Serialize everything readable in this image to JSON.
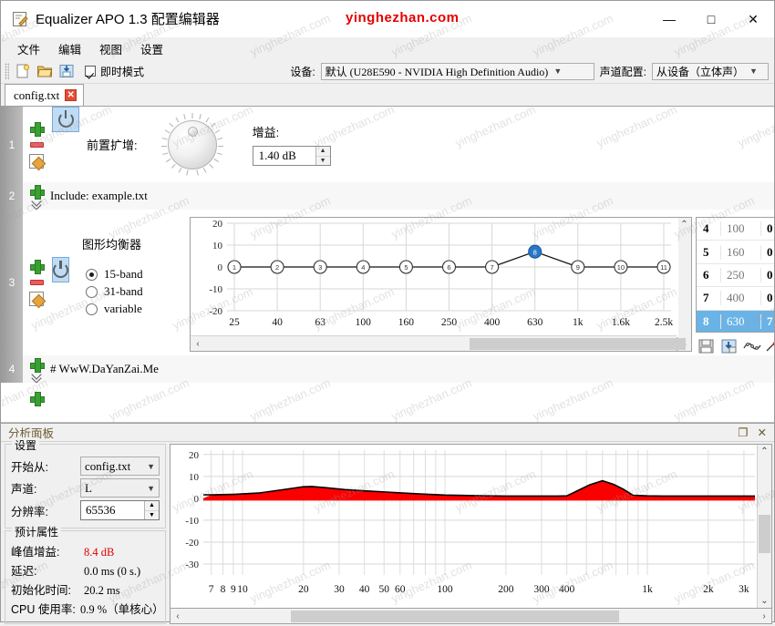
{
  "window": {
    "title": "Equalizer APO 1.3 配置编辑器",
    "app_icon": "editor-icon",
    "minimize": "—",
    "maximize": "□",
    "close": "✕",
    "watermark": "yinghezhan.com",
    "watermark_tile": "yinghezhan.com"
  },
  "menu": {
    "items": [
      "文件",
      "编辑",
      "视图",
      "设置"
    ]
  },
  "toolbar": {
    "new_icon": "new-file-icon",
    "open_icon": "open-folder-icon",
    "save_icon": "save-icon",
    "instant_mode_label": "即时模式",
    "instant_mode_checked": true,
    "device_label": "设备:",
    "device_value": "默认 (U28E590 - NVIDIA High Definition Audio)",
    "channel_config_label": "声道配置:",
    "channel_config_value": "从设备（立体声）"
  },
  "tabs": [
    {
      "label": "config.txt",
      "close": "✕",
      "active": true
    }
  ],
  "filters": [
    {
      "num": "1",
      "type": "preamp",
      "name": "前置扩增:",
      "gain_label": "增益:",
      "gain_value": "1.40 dB",
      "enabled": true
    },
    {
      "num": "2",
      "type": "include",
      "text": "Include: example.txt"
    },
    {
      "num": "3",
      "type": "graphic-eq",
      "name": "图形均衡器",
      "enabled": true,
      "band_modes": [
        {
          "label": "15-band",
          "selected": true
        },
        {
          "label": "31-band",
          "selected": false
        },
        {
          "label": "variable",
          "selected": false
        }
      ]
    },
    {
      "num": "4",
      "type": "comment",
      "text": "# WwW.DaYanZai.Me"
    }
  ],
  "eq_chart": {
    "type": "line",
    "title": "",
    "ylabel": "",
    "xlabel": "",
    "ylim": [
      -20,
      20
    ],
    "yticks": [
      20,
      10,
      0,
      -10,
      -20
    ],
    "categories": [
      "25",
      "40",
      "63",
      "100",
      "160",
      "250",
      "400",
      "630",
      "1k",
      "1.6k",
      "2.5k"
    ],
    "point_labels": [
      "1",
      "2",
      "3",
      "4",
      "5",
      "6",
      "7",
      "8",
      "9",
      "10",
      "11"
    ],
    "values": [
      0,
      0,
      0,
      0,
      0,
      0,
      0,
      7,
      0,
      0,
      0
    ],
    "selected_index": 7,
    "selected_color": "#2878c8",
    "grid": true,
    "scroll_left_icon": "‹",
    "scroll_right_icon": "›",
    "scroll_up_icon": "⌃",
    "scroll_down_icon": "⌄"
  },
  "eq_table": {
    "rows": [
      {
        "n": "4",
        "freq": "100",
        "gain": "0",
        "selected": false
      },
      {
        "n": "5",
        "freq": "160",
        "gain": "0",
        "selected": false
      },
      {
        "n": "6",
        "freq": "250",
        "gain": "0",
        "selected": false
      },
      {
        "n": "7",
        "freq": "400",
        "gain": "0",
        "selected": false
      },
      {
        "n": "8",
        "freq": "630",
        "gain": "7",
        "selected": true
      }
    ],
    "tools": [
      "open-preset-icon",
      "save-preset-icon",
      "flat-curve-icon",
      "invert-curve-icon",
      "smooth-curve-icon"
    ]
  },
  "analysis": {
    "panel_title": "分析面板",
    "float_icon": "❐",
    "close_icon": "✕",
    "settings_caption": "设置",
    "start_from_label": "开始从:",
    "start_from_value": "config.txt",
    "channel_label": "声道:",
    "channel_value": "L",
    "resolution_label": "分辨率:",
    "resolution_value": "65536",
    "props_caption": "预计属性",
    "peak_gain_label": "峰值增益:",
    "peak_gain_value": "8.4 dB",
    "latency_label": "延迟:",
    "latency_value": "0.0 ms (0 s.)",
    "init_time_label": "初始化时间:",
    "init_time_value": "20.2 ms",
    "cpu_label": "CPU 使用率:",
    "cpu_value": "0.9 %（单核心）"
  },
  "analysis_chart": {
    "type": "area",
    "title": "",
    "xlabel": "",
    "ylabel": "",
    "ylim": [
      -35,
      22
    ],
    "yticks": [
      20,
      10,
      0,
      -10,
      -20,
      -30
    ],
    "xticks": [
      "7",
      "8",
      "9",
      "10",
      "20",
      "30",
      "40",
      "50",
      "60",
      "100",
      "200",
      "300",
      "400",
      "1k",
      "2k",
      "3k"
    ],
    "fill_color": "#fa0000",
    "line_color": "#000000",
    "x": [
      7,
      9,
      12,
      16,
      20,
      22,
      26,
      32,
      40,
      55,
      75,
      100,
      150,
      200,
      280,
      360,
      400,
      450,
      520,
      600,
      680,
      760,
      850,
      1000,
      1200,
      1600,
      2200,
      3000
    ],
    "y": [
      1.6,
      1.8,
      2.4,
      4.0,
      5.3,
      5.4,
      4.8,
      4.0,
      3.4,
      2.7,
      2.0,
      1.5,
      1.2,
      1.0,
      1.0,
      1.0,
      1.1,
      3.4,
      6.2,
      8.0,
      6.4,
      4.2,
      1.4,
      1.1,
      1.0,
      1.0,
      1.0,
      1.0
    ],
    "grid": true,
    "scroll_left_icon": "‹",
    "scroll_right_icon": "›"
  }
}
